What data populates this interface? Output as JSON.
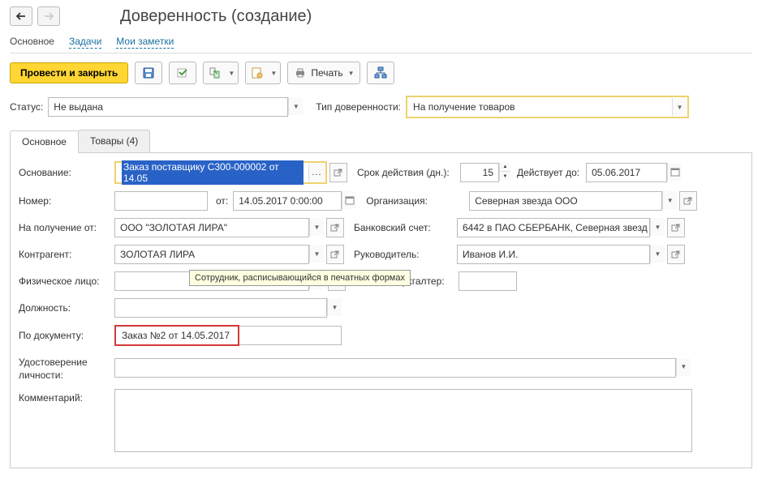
{
  "header": {
    "title": "Доверенность (создание)"
  },
  "navTabs": [
    "Основное",
    "Задачи",
    "Мои заметки"
  ],
  "toolbar": {
    "main_btn": "Провести и закрыть",
    "print": "Печать"
  },
  "status": {
    "label": "Статус:",
    "value": "Не выдана",
    "type_label": "Тип доверенности:",
    "type_value": "На получение товаров"
  },
  "tabs": {
    "main": "Основное",
    "goods": "Товары (4)"
  },
  "form": {
    "basis_label": "Основание:",
    "basis_value": "Заказ поставщику С300-000002 от 14.05",
    "duration_label": "Срок действия (дн.):",
    "duration_value": "15",
    "valid_until_label": "Действует до:",
    "valid_until_value": "05.06.2017",
    "number_label": "Номер:",
    "number_value": "",
    "ot": "от:",
    "date_value": "14.05.2017  0:00:00",
    "org_label": "Организация:",
    "org_value": "Северная звезда ООО",
    "received_from_label": "На получение от:",
    "received_from_value": "ООО \"ЗОЛОТАЯ ЛИРА\"",
    "bank_label": "Банковский счет:",
    "bank_value": "6442 в ПАО СБЕРБАНК, Северная звезд",
    "counterparty_label": "Контрагент:",
    "counterparty_value": "ЗОЛОТАЯ ЛИРА",
    "manager_label": "Руководитель:",
    "manager_value": "Иванов И.И.",
    "person_label": "Физическое лицо:",
    "person_value": "",
    "accountant_label": "Главный бухгалтер:",
    "accountant_value": "",
    "position_label": "Должность:",
    "position_value": "",
    "doc_label": "По документу:",
    "doc_value": "Заказ №2 от 14.05.2017",
    "identity_label": "Удостоверение личности:",
    "identity_value": "",
    "comment_label": "Комментарий:",
    "comment_value": ""
  },
  "tooltip": "Сотрудник, расписывающийся в печатных формах"
}
